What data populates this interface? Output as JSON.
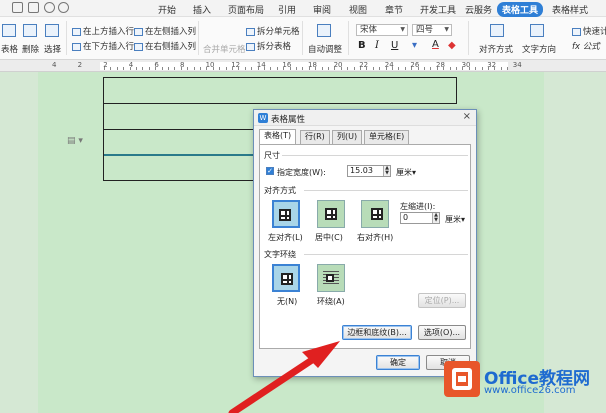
{
  "menubar": {
    "tabs": [
      "开始",
      "插入",
      "页面布局",
      "引用",
      "审阅",
      "视图",
      "章节",
      "开发工具",
      "云服务",
      "表格工具",
      "表格样式"
    ],
    "active_tab": "表格工具",
    "accent_color": "#2f7fd6"
  },
  "ribbon": {
    "table_label": "表格",
    "delete_label": "删除",
    "select_label": "选择",
    "insert_above": "在上方插入行",
    "insert_below": "在下方插入行",
    "insert_left": "在左侧插入列",
    "insert_right": "在右侧插入列",
    "merge_cells": "合并单元格",
    "split_cells": "拆分单元格",
    "split_table": "拆分表格",
    "autofit": "自动调整",
    "font_name": "宋体",
    "font_size": "四号",
    "bold": "B",
    "italic": "I",
    "underline": "U",
    "align": "对齐方式",
    "text_direction": "文字方向",
    "quick_calc": "快速计",
    "formula": "fx 公式"
  },
  "ruler": {
    "numbers": [
      "4",
      "2",
      "2",
      "4",
      "6",
      "8",
      "10",
      "12",
      "14",
      "16",
      "18",
      "20",
      "22",
      "24",
      "26",
      "28",
      "30",
      "32",
      "34"
    ]
  },
  "dialog": {
    "title": "表格属性",
    "close": "×",
    "tabs": [
      "表格(T)",
      "行(R)",
      "列(U)",
      "单元格(E)"
    ],
    "active_tab": "表格(T)",
    "size_section": "尺寸",
    "width_checkbox": "✓",
    "width_label": "指定宽度(W):",
    "width_value": "15.03",
    "width_unit": "厘米",
    "align_section": "对齐方式",
    "align_options": [
      "左对齐(L)",
      "居中(C)",
      "右对齐(H)"
    ],
    "selected_align": "左对齐(L)",
    "indent_label": "左缩进(I):",
    "indent_value": "0",
    "indent_unit": "厘米",
    "wrap_section": "文字环绕",
    "wrap_options": [
      "无(N)",
      "环绕(A)"
    ],
    "selected_wrap": "无(N)",
    "position_button": "定位(P)...",
    "borders_button": "边框和底纹(B)...",
    "options_button": "选项(O)...",
    "ok_button": "确定",
    "cancel_button": "取消"
  },
  "watermark": {
    "brand": "Office教程网",
    "url": "www.office26.com",
    "arrow_color": "#e02020"
  }
}
